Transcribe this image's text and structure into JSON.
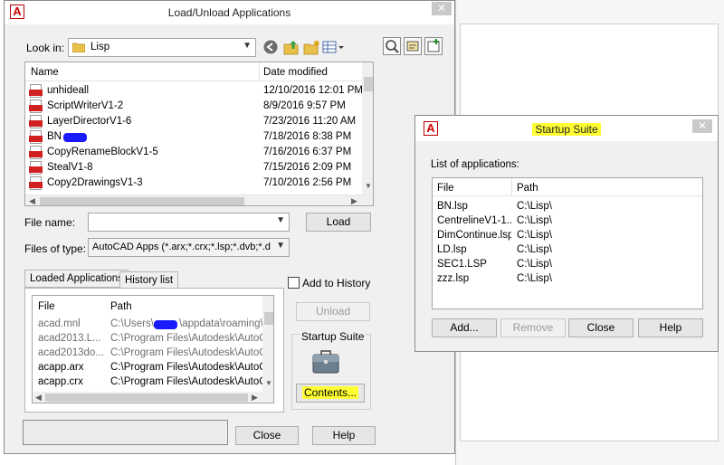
{
  "main_dialog": {
    "title": "Load/Unload Applications",
    "close_glyph": "✕",
    "look_in_label": "Look in:",
    "look_in_value": "Lisp",
    "columns": {
      "name": "Name",
      "date_modified": "Date modified"
    },
    "files": [
      {
        "name": "unhideall",
        "date": "12/10/2016 12:01 PM"
      },
      {
        "name": "ScriptWriterV1-2",
        "date": "8/9/2016 9:57 PM"
      },
      {
        "name": "LayerDirectorV1-6",
        "date": "7/23/2016 11:20 AM"
      },
      {
        "name": "BN",
        "date": "7/18/2016 8:38 PM"
      },
      {
        "name": "CopyRenameBlockV1-5",
        "date": "7/16/2016 6:37 PM"
      },
      {
        "name": "StealV1-8",
        "date": "7/15/2016 2:09 PM"
      },
      {
        "name": "Copy2DrawingsV1-3",
        "date": "7/10/2016 2:56 PM"
      }
    ],
    "file_name_label": "File name:",
    "file_name_value": "",
    "files_of_type_label": "Files of type:",
    "files_of_type_value": "AutoCAD Apps (*.arx;*.crx;*.lsp;*.dvb;*.dbx;*.",
    "load_button": "Load",
    "tabs": [
      "Loaded Applications",
      "History list"
    ],
    "add_to_history_label": "Add to History",
    "loaded_columns": {
      "file": "File",
      "path": "Path"
    },
    "loaded_apps": [
      {
        "file": "acad.mnl",
        "path": "C:\\Users\\",
        "path_tail": "\\appdata\\roaming\\a...",
        "greyed": true
      },
      {
        "file": "acad2013.L...",
        "path": "C:\\Program Files\\Autodesk\\AutoCA...",
        "greyed": true
      },
      {
        "file": "acad2013do...",
        "path": "C:\\Program Files\\Autodesk\\AutoCA...",
        "greyed": true
      },
      {
        "file": "acapp.arx",
        "path": "C:\\Program Files\\Autodesk\\AutoCA...",
        "greyed": false
      },
      {
        "file": "acapp.crx",
        "path": "C:\\Program Files\\Autodesk\\AutoCA...",
        "greyed": false
      }
    ],
    "unload_button": "Unload",
    "startup_suite_label": "Startup Suite",
    "contents_button": "Contents...",
    "close_button": "Close",
    "help_button": "Help"
  },
  "startup_dialog": {
    "title": "Startup Suite",
    "close_glyph": "✕",
    "list_label": "List of applications:",
    "columns": {
      "file": "File",
      "path": "Path"
    },
    "apps": [
      {
        "file": "BN.lsp",
        "path": "C:\\Lisp\\"
      },
      {
        "file": "CentrelineV1-1...",
        "path": "C:\\Lisp\\"
      },
      {
        "file": "DimContinue.lsp",
        "path": "C:\\Lisp\\"
      },
      {
        "file": "LD.lsp",
        "path": "C:\\Lisp\\"
      },
      {
        "file": "SEC1.LSP",
        "path": "C:\\Lisp\\"
      },
      {
        "file": "zzz.lsp",
        "path": "C:\\Lisp\\"
      }
    ],
    "add_button": "Add...",
    "remove_button": "Remove",
    "close_button": "Close",
    "help_button": "Help"
  },
  "colors": {
    "highlight": "#ffff33",
    "redaction": "#1a1aff",
    "lsp_icon": "#d02020"
  }
}
